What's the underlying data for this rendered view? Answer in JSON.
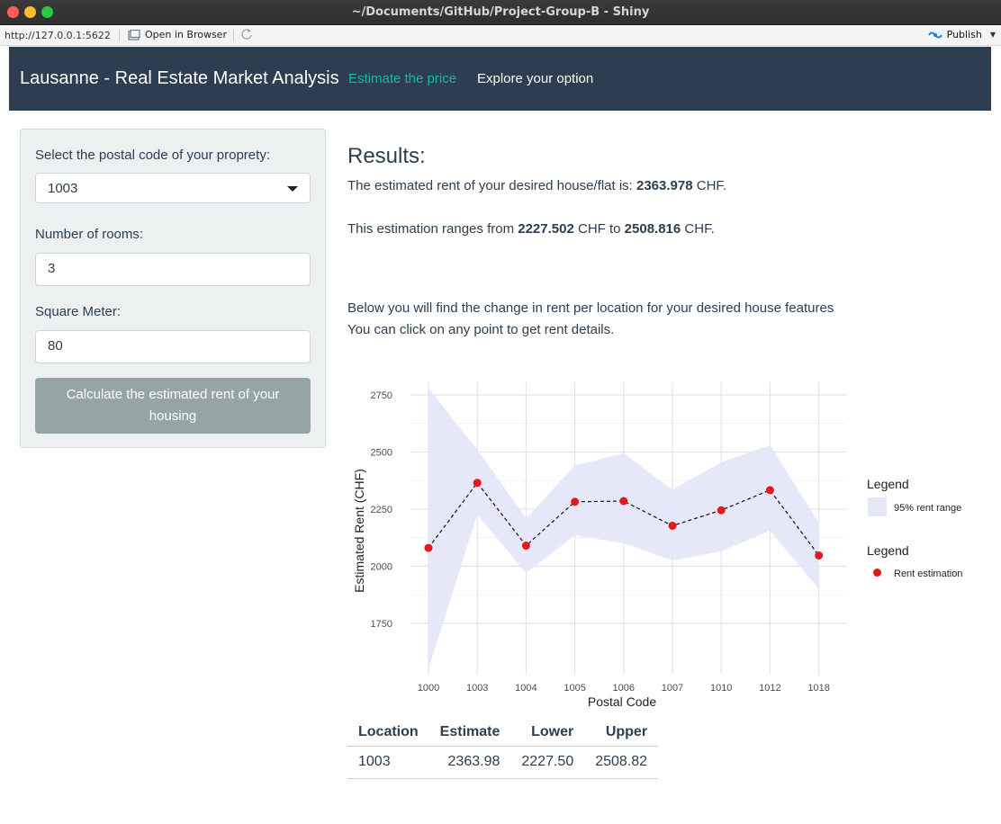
{
  "window": {
    "title": "~/Documents/GitHub/Project-Group-B - Shiny"
  },
  "toolbar": {
    "url": "http://127.0.0.1:5622",
    "open_in_browser": "Open in Browser",
    "publish": "Publish"
  },
  "navbar": {
    "brand": "Lausanne - Real Estate Market Analysis",
    "tabs": [
      {
        "label": "Estimate the price",
        "active": true
      },
      {
        "label": "Explore your option",
        "active": false
      }
    ]
  },
  "sidebar": {
    "postal_label": "Select the postal code of your proprety:",
    "postal_value": "1003",
    "rooms_label": "Number of rooms:",
    "rooms_value": "3",
    "sqm_label": "Square Meter:",
    "sqm_value": "80",
    "button_line1": "Calculate the estimated rent of your",
    "button_line2": "housing"
  },
  "results": {
    "title": "Results:",
    "rent_prefix": "The estimated rent of your desired house/flat is: ",
    "rent_value": "2363.978",
    "rent_suffix": " CHF.",
    "range_prefix": "This estimation ranges from ",
    "range_low": "2227.502",
    "range_mid": " CHF to ",
    "range_high": "2508.816",
    "range_suffix": " CHF.",
    "info_line1": "Below you will find the change in rent per location for your desired house features",
    "info_line2": "You can click on any point to get rent details."
  },
  "colors": {
    "navbar": "#2c3e50",
    "accent": "#18bc9c",
    "button": "#95a5a6",
    "band": "#e6e6fa",
    "point": "#e31a1c"
  },
  "chart_data": {
    "type": "line",
    "categories": [
      "1000",
      "1003",
      "1004",
      "1005",
      "1006",
      "1007",
      "1010",
      "1012",
      "1018"
    ],
    "series": [
      {
        "name": "Rent estimation",
        "values": [
          2080,
          2365,
          2090,
          2282,
          2285,
          2177,
          2245,
          2333,
          2047
        ]
      }
    ],
    "band": {
      "name": "95% rent range",
      "lower": [
        1550,
        2225,
        1970,
        2135,
        2100,
        2025,
        2065,
        2155,
        1900
      ],
      "upper": [
        2780,
        2510,
        2210,
        2440,
        2495,
        2335,
        2455,
        2530,
        2190
      ]
    },
    "xlabel": "Postal Code",
    "ylabel": "Estimated Rent (CHF)",
    "yticks": [
      1750,
      2000,
      2250,
      2500,
      2750
    ],
    "ylim": [
      1525,
      2805
    ],
    "grid": true,
    "legend": [
      {
        "title": "Legend",
        "item": "95% rent range"
      },
      {
        "title": "Legend",
        "item": "Rent estimation"
      }
    ],
    "legend_position": "right"
  },
  "table": {
    "headers": [
      "Location",
      "Estimate",
      "Lower",
      "Upper"
    ],
    "rows": [
      [
        "1003",
        "2363.98",
        "2227.50",
        "2508.82"
      ]
    ]
  }
}
